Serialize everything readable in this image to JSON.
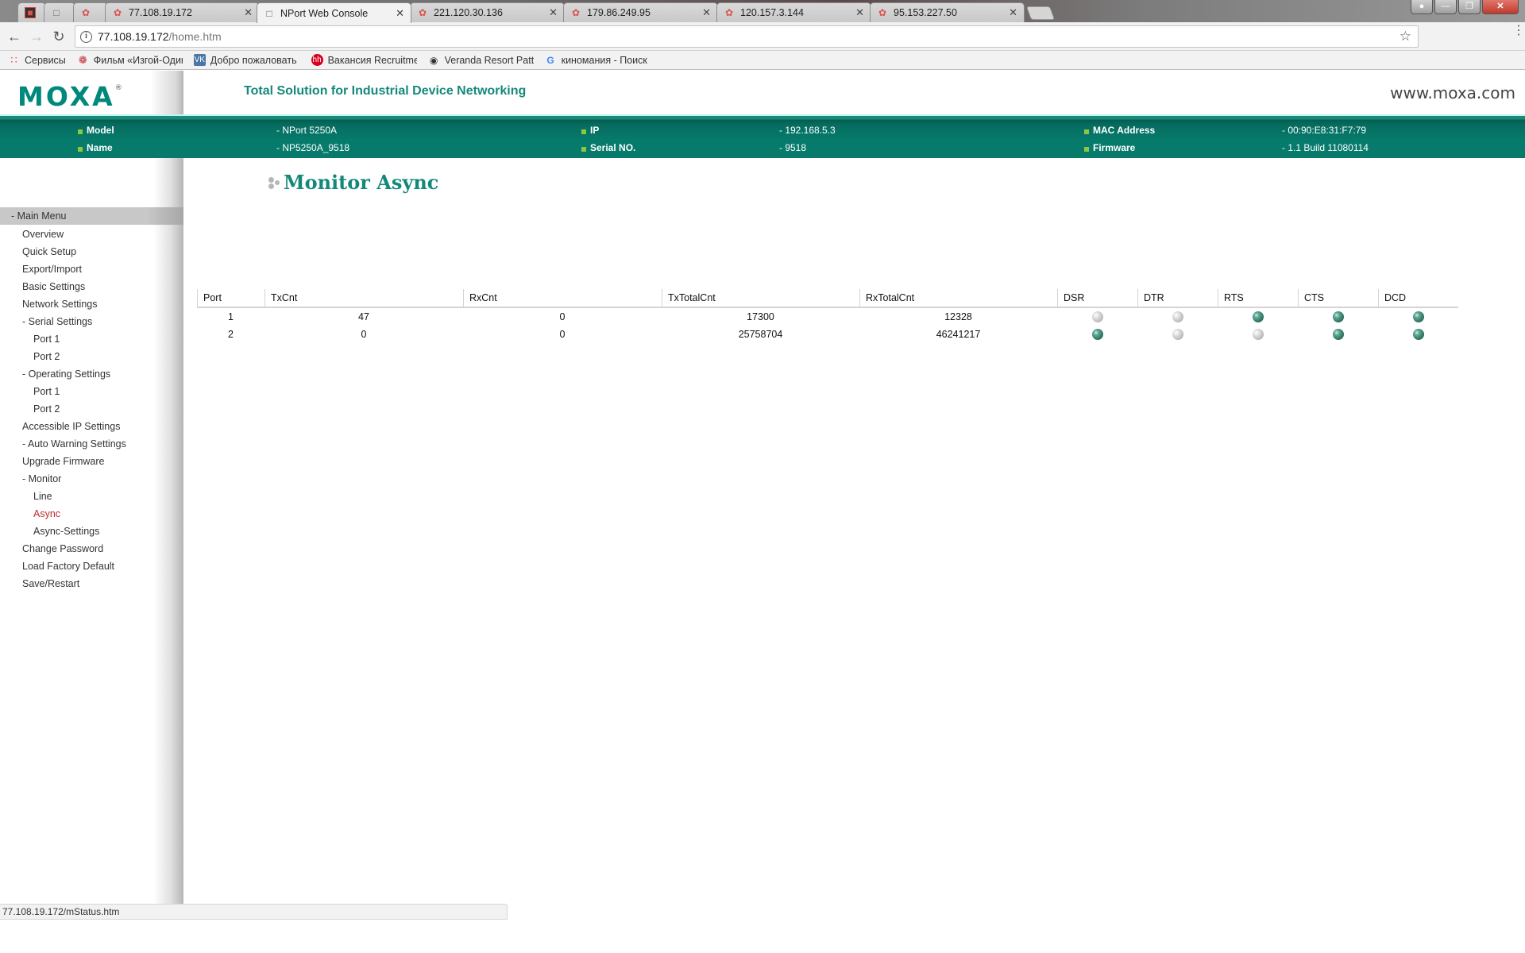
{
  "browser": {
    "tabs": [
      {
        "title": "",
        "icon": "profile-icon",
        "active": false
      },
      {
        "title": "",
        "icon": "page-icon",
        "active": false
      },
      {
        "title": "",
        "icon": "moxa-favicon",
        "active": false
      },
      {
        "title": "77.108.19.172",
        "icon": "moxa-favicon",
        "active": false
      },
      {
        "title": "NPort Web Console",
        "icon": "page-icon",
        "active": true
      },
      {
        "title": "221.120.30.136",
        "icon": "moxa-favicon",
        "active": false
      },
      {
        "title": "179.86.249.95",
        "icon": "moxa-favicon",
        "active": false
      },
      {
        "title": "120.157.3.144",
        "icon": "moxa-favicon",
        "active": false
      },
      {
        "title": "95.153.227.50",
        "icon": "moxa-favicon",
        "active": false
      }
    ],
    "url_host": "77.108.19.172",
    "url_path": "/home.htm",
    "bookmarks": [
      {
        "label": "Сервисы",
        "icon": "apps-grid-icon"
      },
      {
        "label": "Фильм «Изгой-Один",
        "icon": "film-icon"
      },
      {
        "label": "Добро пожаловать",
        "icon": "vk-icon"
      },
      {
        "label": "Вакансия Recruitmen",
        "icon": "hh-icon"
      },
      {
        "label": "Veranda Resort Patta",
        "icon": "tripadvisor-icon"
      },
      {
        "label": "киномания - Поиск",
        "icon": "google-icon"
      }
    ],
    "status_url": "77.108.19.172/mStatus.htm"
  },
  "header": {
    "logo": "MOXA",
    "logo_mark": "®",
    "tagline": "Total Solution for Industrial Device Networking",
    "website": "www.moxa.com"
  },
  "device_info": {
    "model_label": "Model",
    "model_value": "- NPort 5250A",
    "name_label": "Name",
    "name_value": "- NP5250A_9518",
    "ip_label": "IP",
    "ip_value": "- 192.168.5.3",
    "serial_label": "Serial NO.",
    "serial_value": "- 9518",
    "mac_label": "MAC Address",
    "mac_value": "- 00:90:E8:31:F7:79",
    "firmware_label": "Firmware",
    "firmware_value": "- 1.1 Build 11080114"
  },
  "sidebar": {
    "header": "- Main Menu",
    "items": [
      {
        "label": "Overview",
        "level": 1
      },
      {
        "label": "Quick Setup",
        "level": 1
      },
      {
        "label": "Export/Import",
        "level": 1
      },
      {
        "label": "Basic Settings",
        "level": 1
      },
      {
        "label": "Network Settings",
        "level": 1
      },
      {
        "label": "- Serial Settings",
        "level": 1
      },
      {
        "label": "Port 1",
        "level": 2
      },
      {
        "label": "Port 2",
        "level": 2
      },
      {
        "label": "- Operating Settings",
        "level": 1
      },
      {
        "label": "Port 1",
        "level": 2
      },
      {
        "label": "Port 2",
        "level": 2
      },
      {
        "label": "Accessible IP Settings",
        "level": 1
      },
      {
        "label": "- Auto Warning Settings",
        "level": 1
      },
      {
        "label": "Upgrade Firmware",
        "level": 1
      },
      {
        "label": "- Monitor",
        "level": 1
      },
      {
        "label": "Line",
        "level": 2
      },
      {
        "label": "Async",
        "level": 2,
        "active": true
      },
      {
        "label": "Async-Settings",
        "level": 2
      },
      {
        "label": "Change Password",
        "level": 1
      },
      {
        "label": "Load Factory Default",
        "level": 1
      },
      {
        "label": "Save/Restart",
        "level": 1
      }
    ]
  },
  "main": {
    "title": "Monitor Async",
    "table": {
      "columns": [
        "Port",
        "TxCnt",
        "RxCnt",
        "TxTotalCnt",
        "RxTotalCnt",
        "DSR",
        "DTR",
        "RTS",
        "CTS",
        "DCD"
      ],
      "rows": [
        {
          "port": "1",
          "txcnt": "47",
          "rxcnt": "0",
          "txtotal": "17300",
          "rxtotal": "12328",
          "signals": {
            "DSR": "off",
            "DTR": "off",
            "RTS": "on",
            "CTS": "on",
            "DCD": "on"
          }
        },
        {
          "port": "2",
          "txcnt": "0",
          "rxcnt": "0",
          "txtotal": "25758704",
          "rxtotal": "46241217",
          "signals": {
            "DSR": "on",
            "DTR": "off",
            "RTS": "off",
            "CTS": "on",
            "DCD": "on"
          }
        }
      ]
    }
  },
  "colors": {
    "brand_teal": "#14897a",
    "info_bar": "#077a6b",
    "bullet_green": "#8dc63f",
    "active_menu": "#c0272d",
    "led_on": "#2f7564",
    "led_off": "#b5b5b5"
  }
}
